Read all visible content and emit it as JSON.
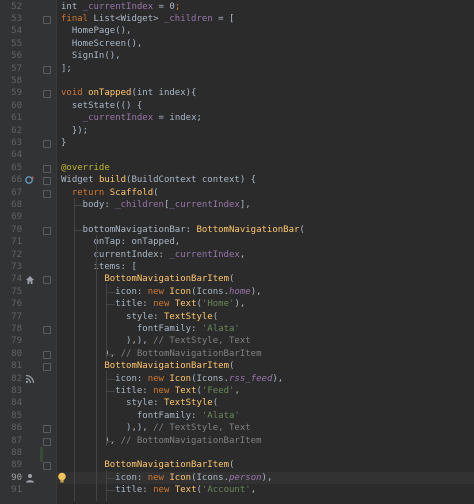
{
  "editor": {
    "line_numbers": [
      "52",
      "53",
      "54",
      "55",
      "56",
      "57",
      "58",
      "59",
      "60",
      "61",
      "62",
      "63",
      "64",
      "65",
      "66",
      "67",
      "68",
      "69",
      "70",
      "71",
      "72",
      "73",
      "74",
      "75",
      "76",
      "77",
      "78",
      "79",
      "80",
      "81",
      "82",
      "83",
      "84",
      "85",
      "86",
      "87",
      "88",
      "89",
      "90",
      "91"
    ],
    "current_line": "90",
    "gutter_icons": {
      "66": "override-indicator-icon",
      "74": "home-icon",
      "82": "rss-feed-icon",
      "90": "person-icon"
    },
    "intention_bulb_line": "90",
    "lines": [
      {
        "n": "52",
        "tokens": [
          [
            "t",
            "int "
          ],
          [
            "fld",
            "_currentIndex"
          ],
          [
            "t",
            " = "
          ],
          [
            "t",
            "0"
          ],
          [
            "k",
            ";"
          ]
        ]
      },
      {
        "n": "53",
        "tokens": [
          [
            "k",
            "final "
          ],
          [
            "t",
            "List<Widget> "
          ],
          [
            "fld",
            "_children"
          ],
          [
            "t",
            " = ["
          ]
        ]
      },
      {
        "n": "54",
        "tokens": [
          [
            "t",
            "  HomePage(),"
          ]
        ]
      },
      {
        "n": "55",
        "tokens": [
          [
            "t",
            "  HomeScreen(),"
          ]
        ]
      },
      {
        "n": "56",
        "tokens": [
          [
            "t",
            "  SignIn(),"
          ]
        ]
      },
      {
        "n": "57",
        "tokens": [
          [
            "t",
            "];"
          ]
        ]
      },
      {
        "n": "58",
        "tokens": []
      },
      {
        "n": "59",
        "tokens": [
          [
            "k",
            "void "
          ],
          [
            "f",
            "onTapped"
          ],
          [
            "t",
            "(int index){"
          ]
        ]
      },
      {
        "n": "60",
        "tokens": [
          [
            "t",
            "  setState(() {"
          ]
        ]
      },
      {
        "n": "61",
        "tokens": [
          [
            "t",
            "    "
          ],
          [
            "fld",
            "_currentIndex"
          ],
          [
            "t",
            " = index;"
          ]
        ]
      },
      {
        "n": "62",
        "tokens": [
          [
            "t",
            "  });"
          ]
        ]
      },
      {
        "n": "63",
        "tokens": [
          [
            "t",
            "}"
          ]
        ]
      },
      {
        "n": "64",
        "tokens": []
      },
      {
        "n": "65",
        "tokens": [
          [
            "ann",
            "@override"
          ]
        ]
      },
      {
        "n": "66",
        "tokens": [
          [
            "t",
            "Widget "
          ],
          [
            "f",
            "build"
          ],
          [
            "t",
            "(BuildContext context) {"
          ]
        ]
      },
      {
        "n": "67",
        "tokens": [
          [
            "t",
            "  "
          ],
          [
            "k",
            "return "
          ],
          [
            "f",
            "Scaffold"
          ],
          [
            "t",
            "("
          ]
        ]
      },
      {
        "n": "68",
        "tokens": [
          [
            "t",
            "    body: "
          ],
          [
            "fld",
            "_children"
          ],
          [
            "t",
            "["
          ],
          [
            "fld",
            "_currentIndex"
          ],
          [
            "t",
            "],"
          ]
        ]
      },
      {
        "n": "69",
        "tokens": []
      },
      {
        "n": "70",
        "tokens": [
          [
            "t",
            "    bottomNavigationBar: "
          ],
          [
            "f",
            "BottomNavigationBar"
          ],
          [
            "t",
            "("
          ]
        ]
      },
      {
        "n": "71",
        "tokens": [
          [
            "t",
            "      onTap: onTapped,"
          ]
        ]
      },
      {
        "n": "72",
        "tokens": [
          [
            "t",
            "      currentIndex: "
          ],
          [
            "fld",
            "_currentIndex"
          ],
          [
            "t",
            ","
          ]
        ]
      },
      {
        "n": "73",
        "tokens": [
          [
            "t",
            "      items: ["
          ]
        ]
      },
      {
        "n": "74",
        "tokens": [
          [
            "t",
            "        "
          ],
          [
            "f",
            "BottomNavigationBarItem"
          ],
          [
            "t",
            "("
          ]
        ]
      },
      {
        "n": "75",
        "tokens": [
          [
            "t",
            "          icon: "
          ],
          [
            "k",
            "new "
          ],
          [
            "f",
            "Icon"
          ],
          [
            "t",
            "(Icons."
          ],
          [
            "fldi",
            "home"
          ],
          [
            "t",
            "),"
          ]
        ]
      },
      {
        "n": "76",
        "tokens": [
          [
            "t",
            "          title: "
          ],
          [
            "k",
            "new "
          ],
          [
            "f",
            "Text"
          ],
          [
            "t",
            "("
          ],
          [
            "s",
            "'Home'"
          ],
          [
            "t",
            "),"
          ]
        ]
      },
      {
        "n": "77",
        "tokens": [
          [
            "t",
            "            style: "
          ],
          [
            "f",
            "TextStyle"
          ],
          [
            "t",
            "("
          ]
        ]
      },
      {
        "n": "78",
        "tokens": [
          [
            "t",
            "              fontFamily: "
          ],
          [
            "s",
            "'Alata'"
          ]
        ]
      },
      {
        "n": "79",
        "tokens": [
          [
            "t",
            "            ),), "
          ],
          [
            "c",
            "// TextStyle, Text"
          ]
        ]
      },
      {
        "n": "80",
        "tokens": [
          [
            "t",
            "        ), "
          ],
          [
            "c",
            "// BottomNavigationBarItem"
          ]
        ]
      },
      {
        "n": "81",
        "tokens": [
          [
            "t",
            "        "
          ],
          [
            "f",
            "BottomNavigationBarItem"
          ],
          [
            "t",
            "("
          ]
        ]
      },
      {
        "n": "82",
        "tokens": [
          [
            "t",
            "          icon: "
          ],
          [
            "k",
            "new "
          ],
          [
            "f",
            "Icon"
          ],
          [
            "t",
            "(Icons."
          ],
          [
            "fldi",
            "rss_feed"
          ],
          [
            "t",
            "),"
          ]
        ]
      },
      {
        "n": "83",
        "tokens": [
          [
            "t",
            "          title: "
          ],
          [
            "k",
            "new "
          ],
          [
            "f",
            "Text"
          ],
          [
            "t",
            "("
          ],
          [
            "s",
            "'Feed'"
          ],
          [
            "t",
            ","
          ]
        ]
      },
      {
        "n": "84",
        "tokens": [
          [
            "t",
            "            style: "
          ],
          [
            "f",
            "TextStyle"
          ],
          [
            "t",
            "("
          ]
        ]
      },
      {
        "n": "85",
        "tokens": [
          [
            "t",
            "              fontFamily: "
          ],
          [
            "s",
            "'Alata'"
          ]
        ]
      },
      {
        "n": "86",
        "tokens": [
          [
            "t",
            "            ),), "
          ],
          [
            "c",
            "// TextStyle, Text"
          ]
        ]
      },
      {
        "n": "87",
        "tokens": [
          [
            "t",
            "        ), "
          ],
          [
            "c",
            "// BottomNavigationBarItem"
          ]
        ]
      },
      {
        "n": "88",
        "tokens": []
      },
      {
        "n": "89",
        "tokens": [
          [
            "t",
            "        "
          ],
          [
            "f",
            "BottomNavigationBarItem"
          ],
          [
            "t",
            "("
          ]
        ]
      },
      {
        "n": "90",
        "tokens": [
          [
            "t",
            "          icon: "
          ],
          [
            "k",
            "new "
          ],
          [
            "f",
            "Icon"
          ],
          [
            "t",
            "(Icons."
          ],
          [
            "fldi",
            "person"
          ],
          [
            "t",
            "),"
          ]
        ]
      },
      {
        "n": "91",
        "tokens": [
          [
            "t",
            "          title: "
          ],
          [
            "k",
            "new "
          ],
          [
            "f",
            "Text"
          ],
          [
            "t",
            "("
          ],
          [
            "s",
            "'Account'"
          ],
          [
            "t",
            ","
          ]
        ]
      }
    ]
  }
}
